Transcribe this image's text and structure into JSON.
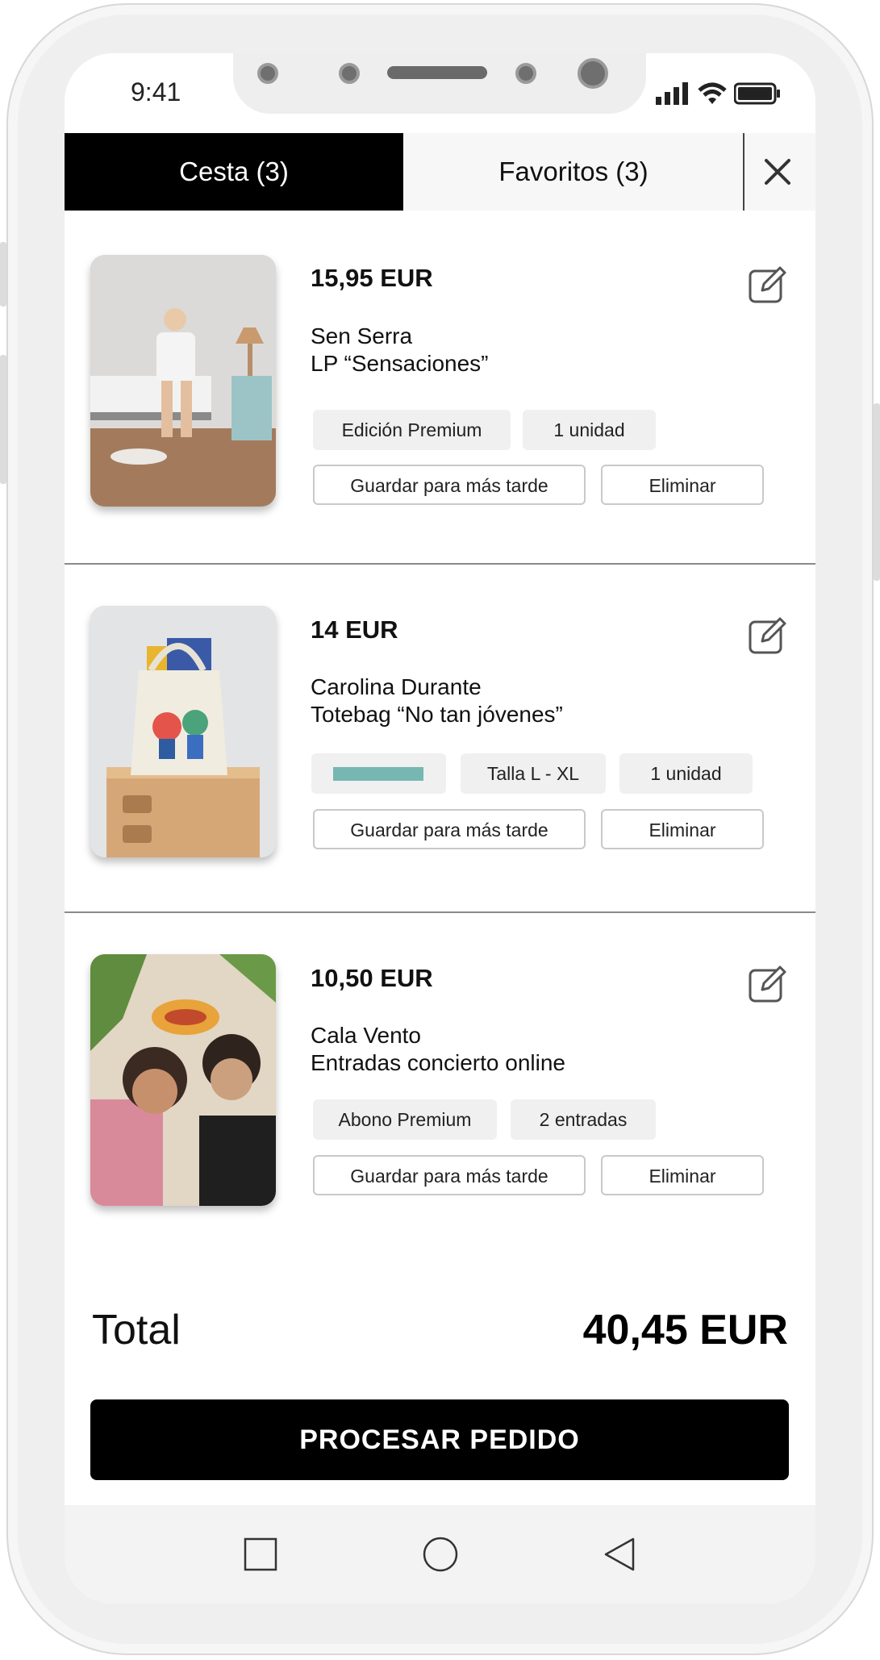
{
  "status": {
    "time": "9:41"
  },
  "tabs": {
    "cart_label": "Cesta (3)",
    "favorites_label": "Favoritos (3)"
  },
  "items": [
    {
      "price": "15,95 EUR",
      "artist": "Sen Serra",
      "product": "LP “Sensaciones”",
      "option1": "Edición Premium",
      "option2": "1 unidad",
      "save_label": "Guardar para más tarde",
      "remove_label": "Eliminar"
    },
    {
      "price": "14 EUR",
      "artist": "Carolina Durante",
      "product": "Totebag “No tan jóvenes”",
      "color_swatch": "#76b7b2",
      "option1": "Talla L - XL",
      "option2": "1 unidad",
      "save_label": "Guardar para más tarde",
      "remove_label": "Eliminar"
    },
    {
      "price": "10,50 EUR",
      "artist": "Cala Vento",
      "product": "Entradas concierto online",
      "option1": "Abono Premium",
      "option2": "2 entradas",
      "save_label": "Guardar para más tarde",
      "remove_label": "Eliminar"
    }
  ],
  "summary": {
    "total_label": "Total",
    "total_value": "40,45 EUR"
  },
  "checkout": {
    "button_label": "PROCESAR PEDIDO"
  },
  "icons": [
    "close-icon",
    "edit-icon",
    "signal-icon",
    "wifi-icon",
    "battery-icon",
    "nav-recent-icon",
    "nav-home-icon",
    "nav-back-icon"
  ]
}
